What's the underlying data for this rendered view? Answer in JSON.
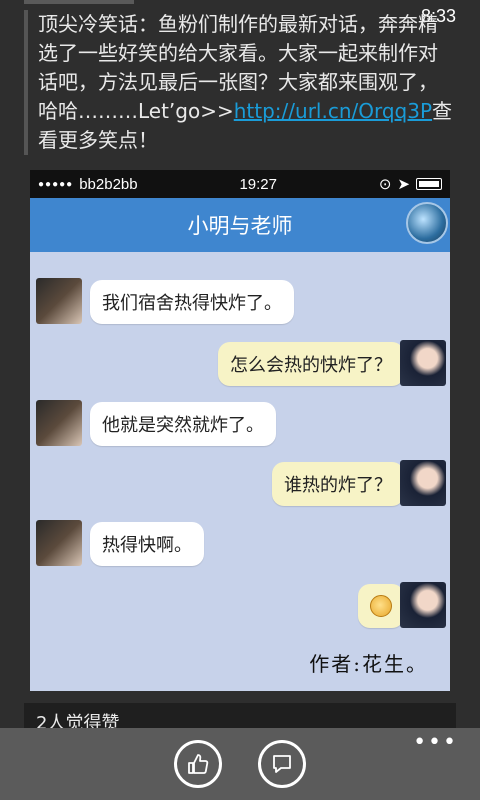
{
  "status": {
    "time": "8:33"
  },
  "post": {
    "text_before_link": "顶尖冷笑话：鱼粉们制作的最新对话，奔奔精选了一些好笑的给大家看。大家一起来制作对话吧，方法见最后一张图？大家都来围观了，哈哈………Let’go>>",
    "link": "http://url.cn/Orqq3P",
    "text_after_link": "查看更多笑点！"
  },
  "screenshot": {
    "ios_carrier": "bb2b2bb",
    "ios_time": "19:27",
    "chat_title": "小明与老师",
    "messages": [
      {
        "side": "left",
        "text": "我们宿舍热得快炸了。"
      },
      {
        "side": "right",
        "text": "怎么会热的快炸了？"
      },
      {
        "side": "left",
        "text": "他就是突然就炸了。"
      },
      {
        "side": "right",
        "text": "谁热的炸了？"
      },
      {
        "side": "left",
        "text": "热得快啊。"
      },
      {
        "side": "right",
        "text": "",
        "emoji": true
      }
    ],
    "author": "作者:花生。"
  },
  "likes": {
    "text": "2人觉得赞"
  },
  "appbar": {
    "more": "•••"
  },
  "colors": {
    "link": "#1a9cd8",
    "chat_header": "#3f86cf",
    "chat_bg": "#c7d2ea",
    "right_bubble": "#f7f3c6"
  }
}
